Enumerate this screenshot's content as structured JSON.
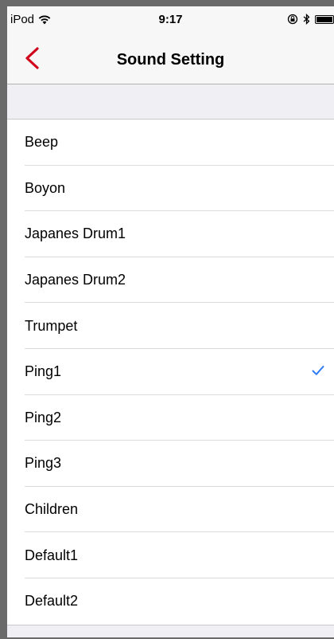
{
  "status_bar": {
    "carrier": "iPod",
    "time": "9:17",
    "icons": [
      "wifi-icon",
      "orientation-lock-icon",
      "bluetooth-icon",
      "battery-icon"
    ]
  },
  "nav": {
    "back_icon": "chevron-left-icon",
    "title": "Sound Setting"
  },
  "colors": {
    "back_accent": "#d0021b",
    "check_accent": "#2f7cf6",
    "separator": "#dcdce0",
    "background": "#efeff4"
  },
  "sounds": [
    {
      "label": "Beep",
      "selected": false
    },
    {
      "label": "Boyon",
      "selected": false
    },
    {
      "label": "Japanes Drum1",
      "selected": false
    },
    {
      "label": "Japanes Drum2",
      "selected": false
    },
    {
      "label": "Trumpet",
      "selected": false
    },
    {
      "label": "Ping1",
      "selected": true
    },
    {
      "label": "Ping2",
      "selected": false
    },
    {
      "label": "Ping3",
      "selected": false
    },
    {
      "label": "Children",
      "selected": false
    },
    {
      "label": "Default1",
      "selected": false
    },
    {
      "label": "Default2",
      "selected": false
    }
  ]
}
